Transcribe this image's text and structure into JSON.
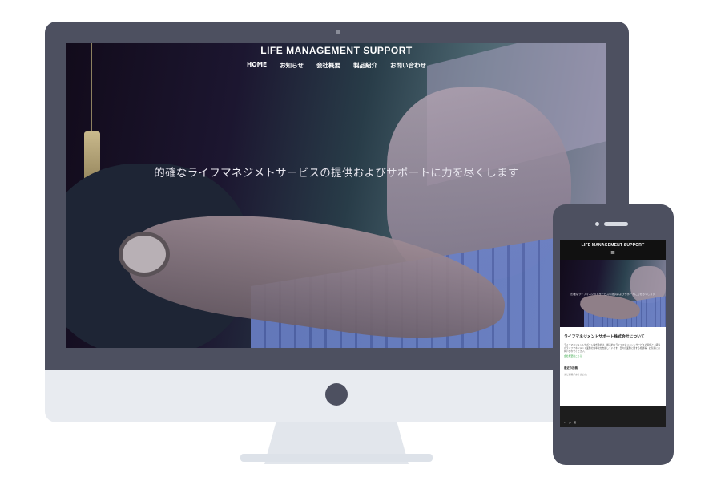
{
  "desktop": {
    "site_title": "LIFE MANAGEMENT SUPPORT",
    "nav": [
      "HOME",
      "お知らせ",
      "会社概要",
      "製品紹介",
      "お問い合わせ"
    ],
    "hero_text": "的確なライフマネジメトサービスの提供およびサポートに力を尽くします"
  },
  "mobile": {
    "site_title": "LIFE MANAGEMENT SUPPORT",
    "menu_icon": "≡",
    "hero_text": "的確なライフマネジメトサービスの提供およびサポートに力を尽くします",
    "about_heading": "ライフマネジメントサポート株式会社について",
    "about_text": "ライフマネジメントサポート株式会社は、確実的なライフマネジメントサービスの提供と、顧客のライフマネジメント業務の効率化を支援しています。日々の業務に関する相談等、お気軽にお問い合わせください。",
    "about_link": "会社概要はこちら",
    "news_heading": "最近の投稿",
    "news_empty": "まだ投稿がありません。",
    "footer_text": "ページ一覧"
  },
  "colors": {
    "device_frame": "#4d5060",
    "monitor_chin": "#e8ebf0",
    "mobile_header": "#111111",
    "link_green": "#3aa84a"
  },
  "icons": [
    "camera-icon",
    "home-button-icon",
    "hamburger-menu-icon"
  ]
}
